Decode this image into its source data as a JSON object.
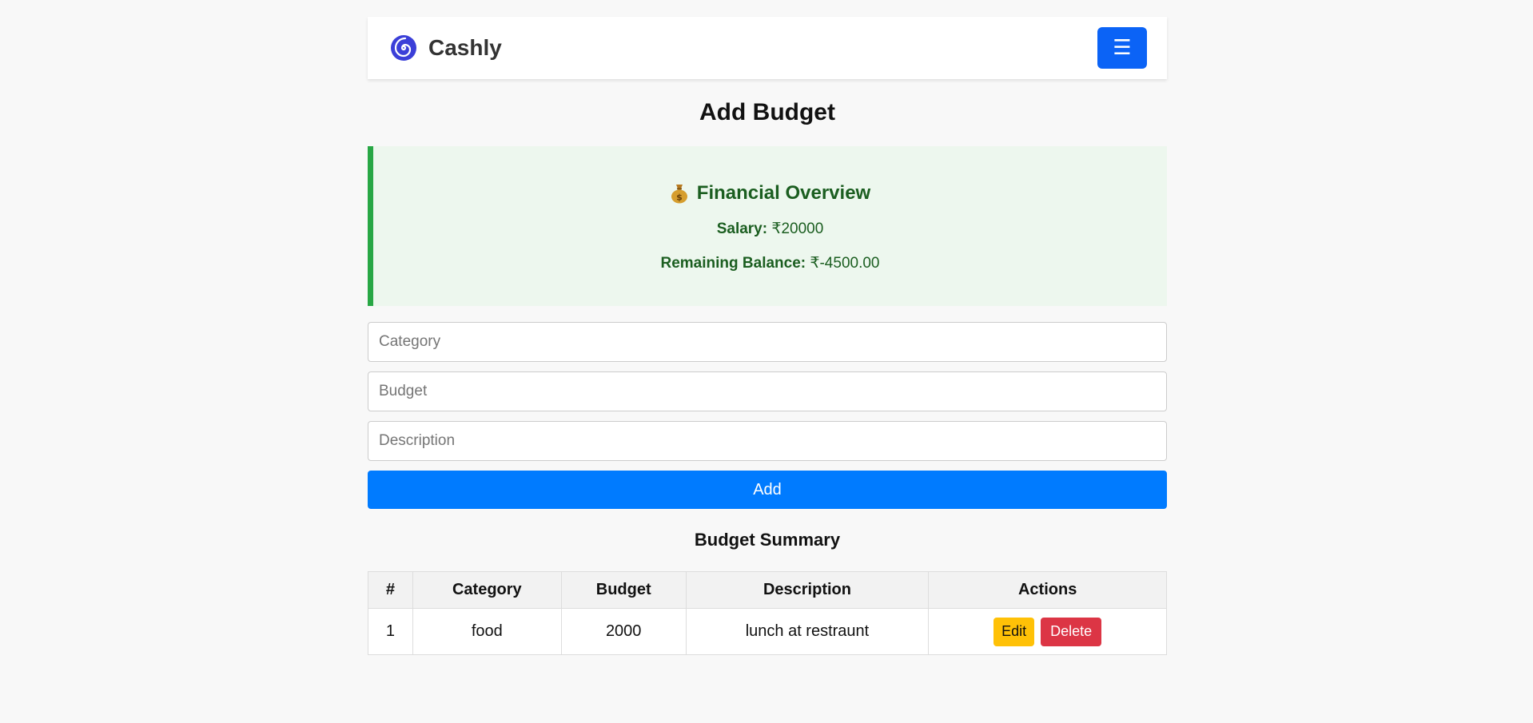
{
  "app": {
    "name": "Cashly",
    "logo_icon": "spiral-logo-icon",
    "menu_label": "☰",
    "menu_icon": "hamburger-menu-icon",
    "accent_color": "#0b63f6"
  },
  "page": {
    "title": "Add Budget"
  },
  "overview": {
    "icon": "money-bag-icon",
    "title": "Financial Overview",
    "salary_label": "Salary:",
    "salary_value": "₹20000",
    "balance_label": "Remaining Balance:",
    "balance_value": "₹-4500.00",
    "accent_color": "#28a745"
  },
  "form": {
    "category_placeholder": "Category",
    "budget_placeholder": "Budget",
    "description_placeholder": "Description",
    "category_value": "",
    "budget_value": "",
    "description_value": "",
    "add_label": "Add"
  },
  "summary": {
    "title": "Budget Summary",
    "columns": [
      "#",
      "Category",
      "Budget",
      "Description",
      "Actions"
    ],
    "rows": [
      {
        "index": "1",
        "category": "food",
        "budget": "2000",
        "description": "lunch at restraunt",
        "edit_label": "Edit",
        "delete_label": "Delete"
      }
    ]
  }
}
